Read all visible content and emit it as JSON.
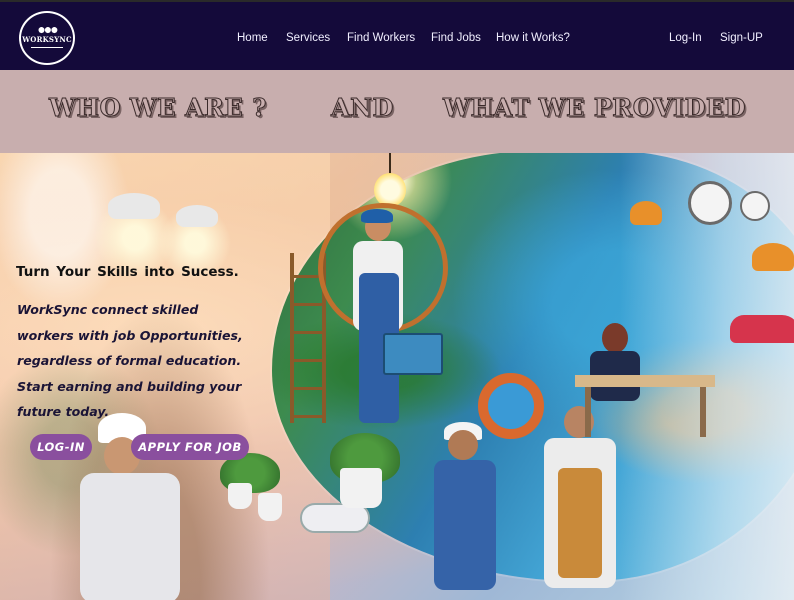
{
  "navbar": {
    "logo_text": "WORKSYNC",
    "links": {
      "home": "Home",
      "services": "Services",
      "find_workers": "Find Workers",
      "find_jobs": "Find Jobs",
      "how_it_works": "How it Works?",
      "login": "Log-In",
      "signup": "Sign-UP"
    }
  },
  "title_band": {
    "part1": "WHO WE ARE ?",
    "part2": "AND",
    "part3": "WHAT WE PROVIDED"
  },
  "hero": {
    "headline": "Turn Your Skills into Sucess.",
    "description_lines": [
      "WorkSync connect skilled",
      "workers with job  Opportunities,",
      "regardless of formal education.",
      "Start earning and building your",
      "future today."
    ],
    "buttons": {
      "login": "LOG-IN",
      "apply": "APPLY FOR JOB"
    }
  },
  "colors": {
    "navbar_bg": "#140a3a",
    "title_band_bg": "#c8aeae",
    "button_bg": "#8a4f9e"
  },
  "icons": {
    "logo": "worksync-people-logo"
  }
}
